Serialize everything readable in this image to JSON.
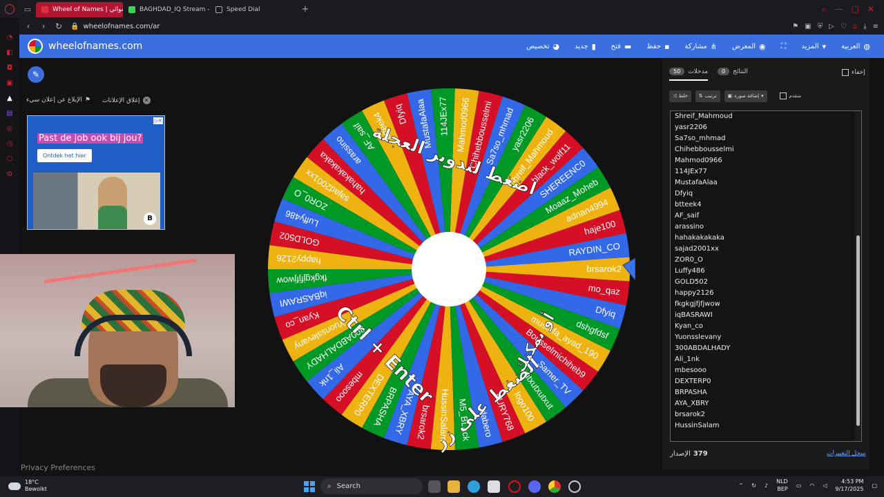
{
  "browser": {
    "tabs": [
      {
        "label": "Wheel of Names | عشوائي",
        "color": "#e0313b"
      },
      {
        "label": "BAGHDAD_IQ Stream - W",
        "color": "#39d353"
      },
      {
        "label": "Speed Dial",
        "color": "#aaaaaa"
      }
    ],
    "url": "wheelofnames.com/ar"
  },
  "site": {
    "name": "wheelofnames.com",
    "menu": [
      {
        "label": "العربية",
        "icon": "globe-icon"
      },
      {
        "label": "المزيد",
        "icon": "chevron-down-icon"
      },
      {
        "label": "",
        "icon": "fullscreen-icon"
      },
      {
        "label": "المعرض",
        "icon": "gallery-icon"
      },
      {
        "label": "مشاركة",
        "icon": "share-icon"
      },
      {
        "label": "حفظ",
        "icon": "save-icon"
      },
      {
        "label": "فتح",
        "icon": "folder-icon"
      },
      {
        "label": "جديد",
        "icon": "file-icon"
      },
      {
        "label": "تخصيص",
        "icon": "palette-icon"
      }
    ]
  },
  "ads": {
    "close_label": "إغلاق الإعلانات",
    "report_label": "الإبلاغ عن إعلان سيء",
    "title": "Past de job ook bij jou?",
    "button": "Ontdek het hier",
    "logo": "B"
  },
  "wheel": {
    "overlay_top": "اضغط لتدوير العجلة",
    "overlay_mid": "أو يمكنك",
    "overlay_bottom": "الضغط على زر",
    "overlay_keys": "Ctrl + Enter",
    "colors": [
      "#3369e8",
      "#d50f25",
      "#eeb211",
      "#009925"
    ],
    "segments": [
      "RAYDIN_CO",
      "haje100",
      "adnan4994",
      "Moaaz_Moheb",
      "SHEREENC0",
      "black_wolf11",
      "Shreif_Mahmoud",
      "yasr2206",
      "Sa7so_mhmad",
      "Chihebbousselmi",
      "Mahmod0966",
      "114JEx77",
      "MustafaAlaa",
      "Dfyiq",
      "btteek4",
      "AF_saif",
      "arassino",
      "hahakakakaka",
      "sajad2001xx",
      "ZOR0_O",
      "Luffy486",
      "GOLD502",
      "happy2126",
      "fkgkgjfjfjwow",
      "iqBASRAWI",
      "Kyan_co",
      "Yuonsslevany",
      "300ABDALHADY",
      "Ali_1nk",
      "mbesooo",
      "DEXTERP0",
      "BRPASHA",
      "AYA_XBRY",
      "brsarok2",
      "HussinSalam",
      "M5_BLack",
      "dabero",
      "FURY768",
      "logo100",
      "xutxutxutxut",
      "Samer_TV",
      "Bousselmichiheb9",
      "mustafa_ayad_190",
      "dshgfdsf",
      "Dfyiq",
      "mo_qaz",
      "brsarok2"
    ]
  },
  "panel": {
    "tab_entries": {
      "label": "مدخلات",
      "count": "50"
    },
    "tab_results": {
      "label": "النتائج",
      "count": "0"
    },
    "hide_label": "إخفاء",
    "shuffle": "خلط",
    "sort": "ترتيب",
    "add_image": "إضافة صورة",
    "advanced": "متقدم",
    "entries": [
      "Shreif_Mahmoud",
      "yasr2206",
      "Sa7so_mhmad",
      "Chihebbousselmi",
      "Mahmod0966",
      "114JEx77",
      "MustafaAlaa",
      "Dfyiq",
      "btteek4",
      "AF_saif",
      "arassino",
      "hahakakakaka",
      "sajad2001xx",
      "ZOR0_O",
      "Luffy486",
      "GOLD502",
      "happy2126",
      "fkgkgjfjfjwow",
      "iqBASRAWI",
      "Kyan_co",
      "Yuonsslevany",
      "300ABDALHADY",
      "Ali_1nk",
      "mbesooo",
      "DEXTERP0",
      "BRPASHA",
      "AYA_XBRY",
      "brsarok2",
      "HussinSalam"
    ],
    "version_label": "الإصدار",
    "version": "379",
    "changelog": "سجل التغييرات"
  },
  "footer": {
    "privacy": "Privacy Preferences"
  },
  "taskbar": {
    "temp": "18°C",
    "weather": "Bewolkt",
    "search": "Search",
    "lang1": "NLD",
    "lang2": "BEP",
    "time": "4:53 PM",
    "date": "9/17/2025"
  }
}
